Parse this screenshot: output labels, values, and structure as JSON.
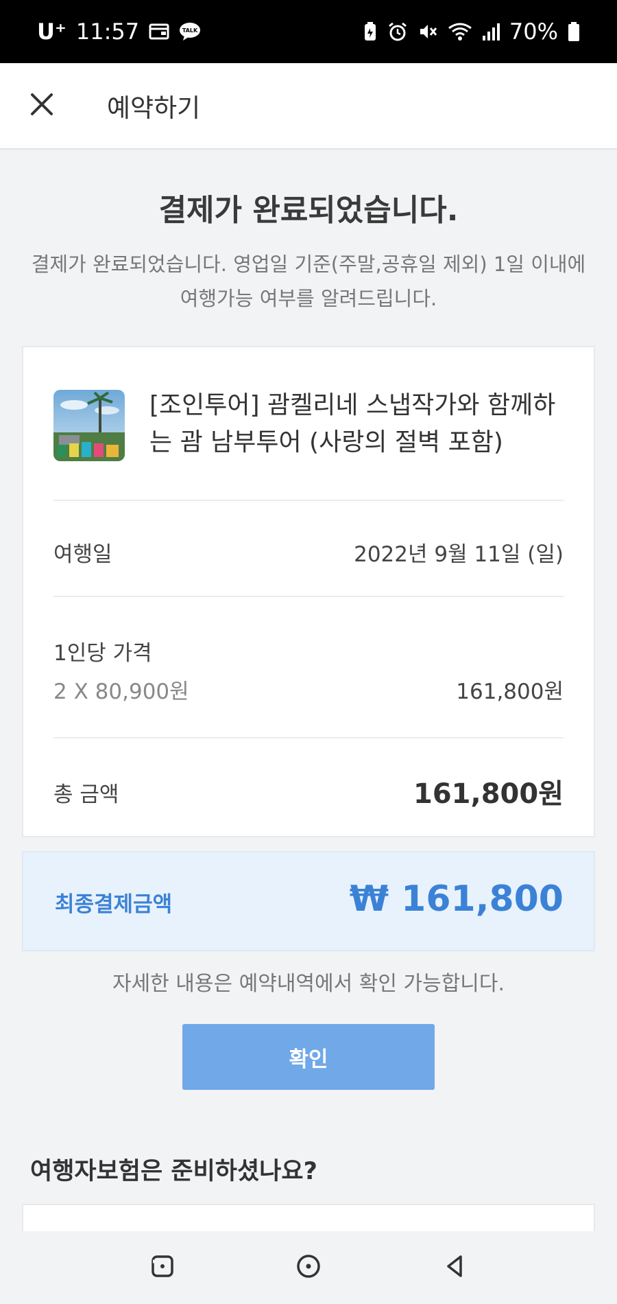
{
  "status_bar": {
    "carrier": "U⁺",
    "time": "11:57",
    "battery": "70%",
    "icons_left": [
      "wallet-icon",
      "kakaotalk-icon"
    ],
    "icons_right": [
      "battery-saver-icon",
      "alarm-icon",
      "mute-icon",
      "wifi-icon",
      "signal-icon",
      "battery-icon"
    ],
    "talk_badge": "TALK"
  },
  "app_bar": {
    "title": "예약하기",
    "close_icon": "close-icon"
  },
  "confirmation": {
    "headline": "결제가 완료되었습니다.",
    "subtext": "결제가 완료되었습니다. 영업일 기준(주말,공휴일 제외) 1일 이내에 여행가능 여부를 알려드립니다."
  },
  "order": {
    "product_title": "[조인투어] 괌켈리네 스냅작가와 함께하는 괌 남부투어 (사랑의 절벽 포함)",
    "travel_date_label": "여행일",
    "travel_date_value": "2022년 9월 11일 (일)",
    "price_per_person_label": "1인당 가격",
    "price_breakdown": "2 X 80,900원",
    "price_subtotal": "161,800원",
    "total_label": "총 금액",
    "total_value": "161,800원"
  },
  "final_payment": {
    "label": "최종결제금액",
    "amount": "₩ 161,800"
  },
  "notice": "자세한 내용은 예약내역에서 확인 가능합니다.",
  "confirm_button": "확인",
  "insurance": {
    "title": "여행자보험은 준비하셨나요?"
  },
  "nav_bar": {
    "icons": [
      "recents-icon",
      "home-icon",
      "back-icon"
    ]
  },
  "colors": {
    "accent": "#3b82d6",
    "button": "#70a8e8",
    "final_box_bg": "#e8f2fc",
    "background": "#f2f3f5"
  }
}
